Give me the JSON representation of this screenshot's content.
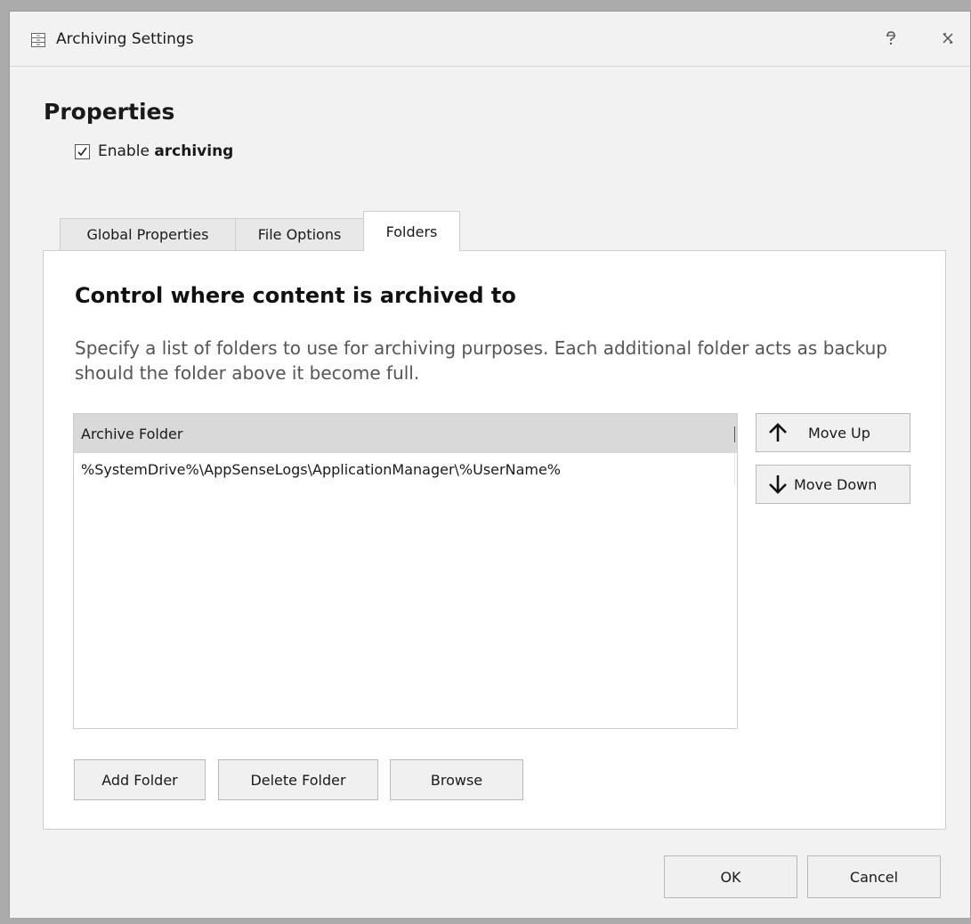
{
  "window": {
    "title": "Archiving Settings",
    "icons": {
      "app": "settings-list-icon",
      "help": "help-icon",
      "close": "close-icon"
    }
  },
  "properties": {
    "heading": "Properties",
    "enable_label_prefix": "Enable ",
    "enable_label_bold": "archiving",
    "enable_checked": true
  },
  "tabs": [
    {
      "label": "Global Properties",
      "active": false
    },
    {
      "label": "File Options",
      "active": false
    },
    {
      "label": "Folders",
      "active": true
    }
  ],
  "folders": {
    "title": "Control where content is archived to",
    "description": "Specify a list of folders to use for archiving purposes. Each additional folder acts as backup should the folder above it become full.",
    "column_header": "Archive Folder",
    "rows": [
      "%SystemDrive%\\AppSenseLogs\\ApplicationManager\\%UserName%"
    ],
    "move_up_label": "Move Up",
    "move_down_label": "Move Down",
    "add_folder_label": "Add Folder",
    "delete_folder_label": "Delete Folder",
    "browse_label": "Browse"
  },
  "footer": {
    "ok_label": "OK",
    "cancel_label": "Cancel"
  }
}
